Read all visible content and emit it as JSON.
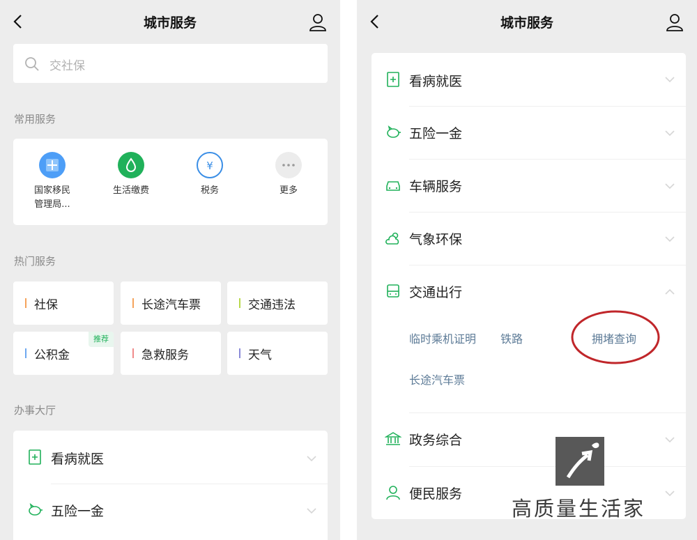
{
  "left": {
    "title": "城市服务",
    "search": {
      "placeholder": "交社保"
    },
    "common": {
      "heading": "常用服务",
      "items": [
        {
          "label": "国家移民\n管理局..."
        },
        {
          "label": "生活缴费"
        },
        {
          "label": "税务"
        },
        {
          "label": "更多"
        }
      ]
    },
    "hot": {
      "heading": "热门服务",
      "items": [
        {
          "label": "社保",
          "color": "#f5a35b"
        },
        {
          "label": "长途汽车票",
          "color": "#f5a35b"
        },
        {
          "label": "交通违法",
          "color": "#b8d94c"
        },
        {
          "label": "公积金",
          "color": "#6ea8f0",
          "badge": "推荐"
        },
        {
          "label": "急救服务",
          "color": "#f08a8a"
        },
        {
          "label": "天气",
          "color": "#8a8ad8"
        }
      ]
    },
    "hall": {
      "heading": "办事大厅",
      "items": [
        {
          "label": "看病就医",
          "icon": "medical-icon"
        },
        {
          "label": "五险一金",
          "icon": "piggy-bank-icon"
        }
      ]
    }
  },
  "right": {
    "title": "城市服务",
    "rows": [
      {
        "label": "看病就医",
        "icon": "medical-icon"
      },
      {
        "label": "五险一金",
        "icon": "piggy-bank-icon"
      },
      {
        "label": "车辆服务",
        "icon": "car-icon"
      },
      {
        "label": "气象环保",
        "icon": "weather-icon"
      },
      {
        "label": "交通出行",
        "icon": "bus-icon",
        "expanded": true
      },
      {
        "label": "政务综合",
        "icon": "government-icon"
      },
      {
        "label": "便民服务",
        "icon": "person-icon"
      }
    ],
    "transport_sublinks": [
      "临时乘机证明",
      "铁路",
      "拥堵查询",
      "长途汽车票"
    ],
    "highlighted_sublink": "拥堵查询",
    "watermark": "高质量生活家"
  },
  "colors": {
    "accent_green": "#20b15a",
    "link_blue": "#5d7b97",
    "annotation_red": "#c0262a"
  }
}
